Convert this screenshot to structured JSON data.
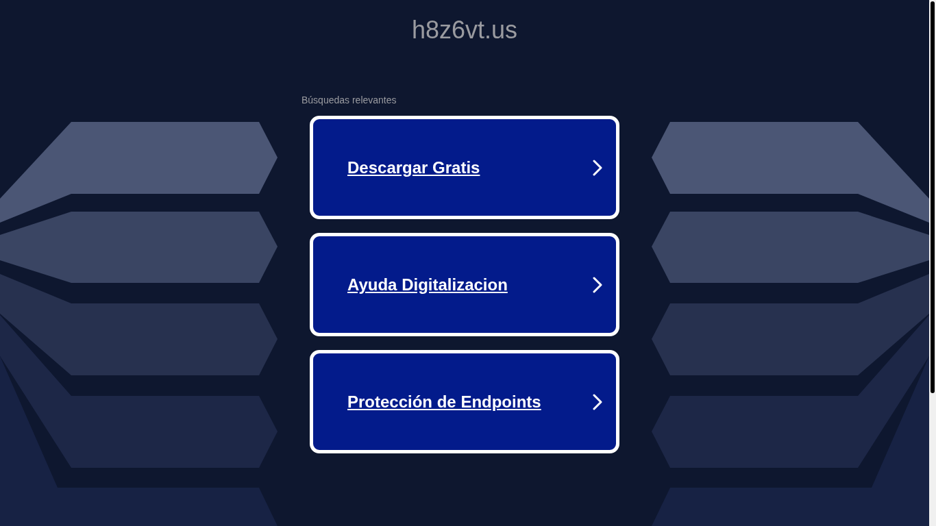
{
  "site_title": "h8z6vt.us",
  "section_label": "Búsquedas relevantes",
  "links": [
    {
      "label": "Descargar Gratis"
    },
    {
      "label": "Ayuda Digitalizacion"
    },
    {
      "label": "Protección de Endpoints"
    }
  ]
}
